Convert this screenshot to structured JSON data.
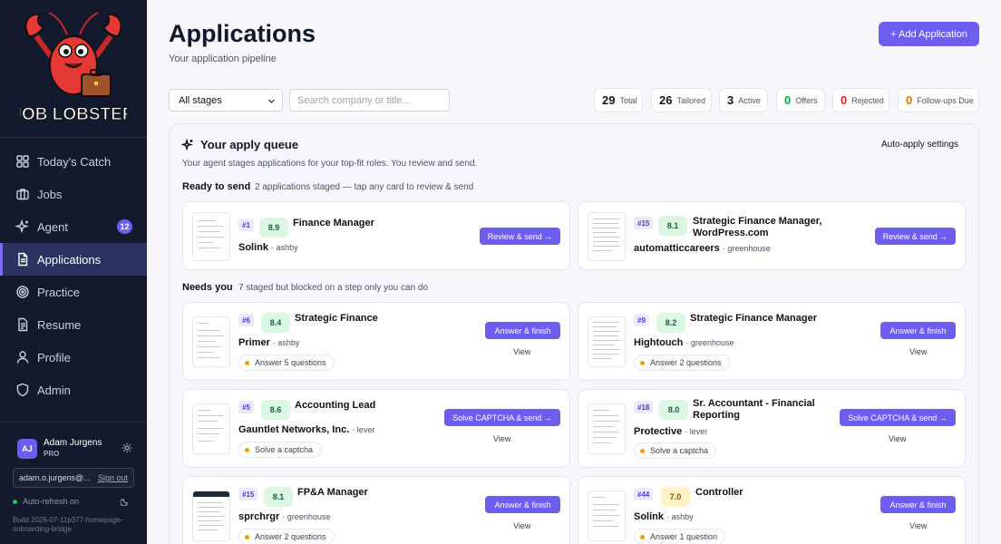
{
  "brand": {
    "name": "JOB LOBSTER"
  },
  "sidebar": {
    "items": [
      {
        "label": "Today's Catch",
        "icon": "grid-icon"
      },
      {
        "label": "Jobs",
        "icon": "briefcase-icon"
      },
      {
        "label": "Agent",
        "icon": "sparkle-icon",
        "badge": "12"
      },
      {
        "label": "Applications",
        "icon": "document-icon",
        "active": true
      },
      {
        "label": "Practice",
        "icon": "target-icon"
      },
      {
        "label": "Resume",
        "icon": "file-text-icon"
      },
      {
        "label": "Profile",
        "icon": "user-icon"
      },
      {
        "label": "Admin",
        "icon": "shield-icon"
      }
    ],
    "user": {
      "initials": "AJ",
      "name": "Adam Jurgens",
      "plan": "PRO",
      "email": "adam.o.jurgens@...",
      "signout": "Sign out"
    },
    "refresh": "Auto-refresh on",
    "build": "Build 2026-07-11p377-homepage-onboarding-bridge"
  },
  "header": {
    "title": "Applications",
    "subtitle": "Your application pipeline",
    "add_button": "+ Add Application"
  },
  "filters": {
    "stage": "All stages",
    "search_placeholder": "Search company or title..."
  },
  "stats": [
    {
      "num": "29",
      "label": "Total",
      "color": "#111827"
    },
    {
      "num": "26",
      "label": "Tailored",
      "color": "#111827"
    },
    {
      "num": "3",
      "label": "Active",
      "color": "#111827"
    },
    {
      "num": "0",
      "label": "Offers",
      "color": "#16a34a"
    },
    {
      "num": "0",
      "label": "Rejected",
      "color": "#dc2626"
    },
    {
      "num": "0",
      "label": "Follow-ups Due",
      "color": "#d97706"
    }
  ],
  "queue": {
    "title": "Your apply queue",
    "settings": "Auto-apply settings",
    "description": "Your agent stages applications for your top-fit roles. You review and send.",
    "ready": {
      "heading": "Ready to send",
      "description": "2 applications staged — tap any card to review & send"
    },
    "needs": {
      "heading": "Needs you",
      "description": "7 staged but blocked on a step only you can do"
    }
  },
  "cards": [
    {
      "rank": "#1",
      "score": "8.9",
      "score_level": "green",
      "title": "Finance Manager",
      "company": "Solink",
      "source": "· ashby",
      "button": "Review & send →"
    },
    {
      "rank": "#15",
      "score": "8.1",
      "score_level": "green",
      "title": "Strategic Finance Manager, WordPress.com",
      "company": "automatticcareers",
      "source": "· greenhouse",
      "button": "Review & send →"
    },
    {
      "rank": "#6",
      "score": "8.4",
      "score_level": "green",
      "title": "Strategic Finance",
      "company": "Primer",
      "source": "· ashby",
      "chip": "Answer 5 questions",
      "button": "Answer & finish",
      "view": "View"
    },
    {
      "rank": "#9",
      "score": "8.2",
      "score_level": "green",
      "title": "Strategic Finance Manager",
      "company": "Hightouch",
      "source": "· greenhouse",
      "chip": "Answer 2 questions",
      "button": "Answer & finish",
      "view": "View"
    },
    {
      "rank": "#5",
      "score": "8.6",
      "score_level": "green",
      "title": "Accounting Lead",
      "company": "Gauntlet Networks, Inc.",
      "source": "· lever",
      "chip": "Solve a captcha",
      "button": "Solve CAPTCHA & send →",
      "view": "View"
    },
    {
      "rank": "#18",
      "score": "8.0",
      "score_level": "green",
      "title": "Sr. Accountant - Financial Reporting",
      "company": "Protective",
      "source": "· lever",
      "chip": "Solve a captcha",
      "button": "Solve CAPTCHA & send →",
      "view": "View"
    },
    {
      "rank": "#15",
      "score": "8.1",
      "score_level": "green",
      "title": "FP&A Manager",
      "company": "sprchrgr",
      "source": "· greenhouse",
      "chip": "Answer 2 questions",
      "button": "Answer & finish",
      "view": "View"
    },
    {
      "rank": "#44",
      "score": "7.0",
      "score_level": "yellow",
      "title": "Controller",
      "company": "Solink",
      "source": "· ashby",
      "chip": "Answer 1 question",
      "button": "Answer & finish",
      "view": "View"
    }
  ]
}
